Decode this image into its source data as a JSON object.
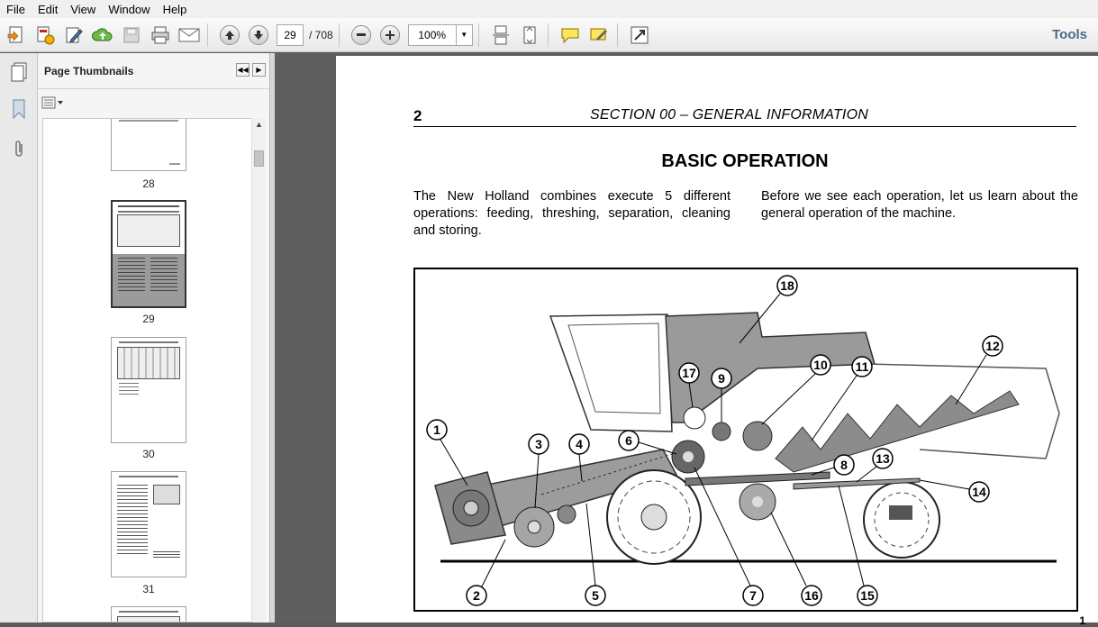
{
  "menu": [
    "File",
    "Edit",
    "View",
    "Window",
    "Help"
  ],
  "toolbar": {
    "current_page": "29",
    "total_pages": "/ 708",
    "zoom": "100%",
    "tools_label": "Tools"
  },
  "sidebar": {
    "title": "Page Thumbnails",
    "thumbnails": [
      {
        "label": "28"
      },
      {
        "label": "29"
      },
      {
        "label": "30"
      },
      {
        "label": "31"
      }
    ]
  },
  "document": {
    "page_number": "2",
    "section_header": "SECTION 00 – GENERAL INFORMATION",
    "title": "BASIC OPERATION",
    "paragraph_left": "The New Holland combines execute 5 different operations: feeding, threshing, separation, cleaning and storing.",
    "paragraph_right": "Before we see each operation, let us learn about the general operation of the machine.",
    "callouts": [
      "1",
      "2",
      "3",
      "4",
      "5",
      "6",
      "7",
      "8",
      "9",
      "10",
      "11",
      "12",
      "13",
      "14",
      "15",
      "16",
      "17",
      "18"
    ],
    "corner_digit": "1"
  }
}
